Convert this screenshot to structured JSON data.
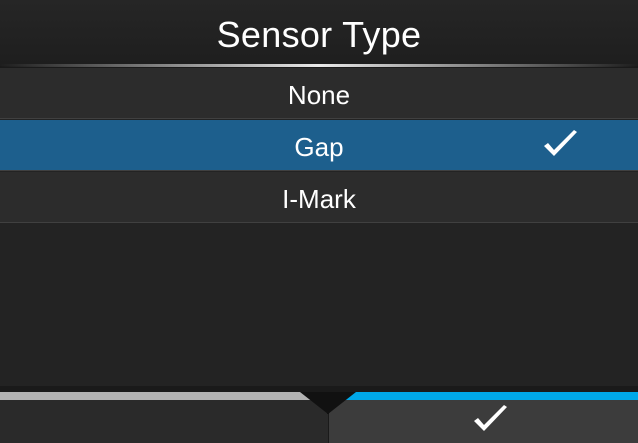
{
  "header": {
    "title": "Sensor Type"
  },
  "options": [
    {
      "label": "None",
      "selected": false
    },
    {
      "label": "Gap",
      "selected": true
    },
    {
      "label": "I-Mark",
      "selected": false
    }
  ],
  "icons": {
    "selected_check": "checkmark-icon",
    "confirm": "checkmark-icon"
  },
  "colors": {
    "selected_row": "#1d5f8d",
    "accent": "#00a8e8",
    "background": "#1a1a1a"
  }
}
